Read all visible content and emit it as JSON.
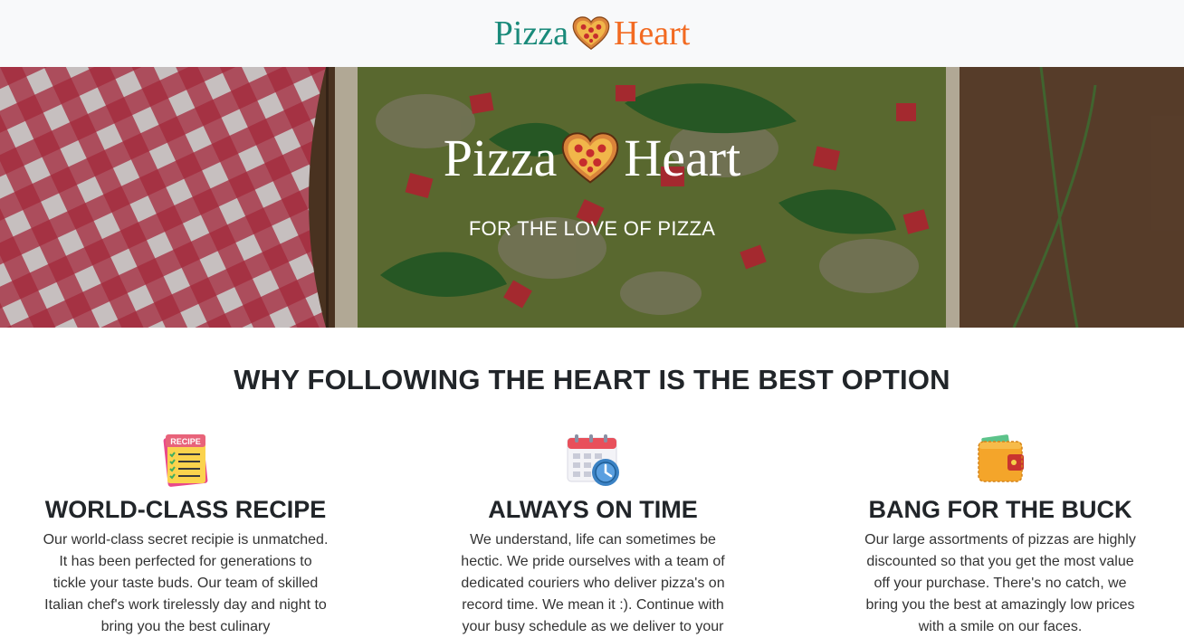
{
  "header": {
    "logo_word1": "Pizza",
    "logo_word2": "Heart"
  },
  "hero": {
    "logo_word1": "Pizza",
    "logo_word2": "Heart",
    "tagline": "FOR THE LOVE OF PIZZA"
  },
  "features": {
    "heading": "WHY FOLLOWING THE HEART IS THE BEST OPTION",
    "items": [
      {
        "icon": "recipe-icon",
        "title": "WORLD-CLASS RECIPE",
        "text": "Our world-class secret recipie is unmatched. It has been perfected for generations to tickle your taste buds. Our team of skilled Italian chef's work tirelessly day and night to bring you the best culinary"
      },
      {
        "icon": "calendar-clock-icon",
        "title": "ALWAYS ON TIME",
        "text": "We understand, life can sometimes be hectic. We pride ourselves with a team of dedicated couriers who deliver pizza's on record time. We mean it :). Continue with your busy schedule as we deliver to your"
      },
      {
        "icon": "wallet-icon",
        "title": "BANG FOR THE BUCK",
        "text": "Our large assortments of pizzas are highly discounted so that you get the most value off your purchase. There's no catch, we bring you the best at amazingly low prices with a smile on our faces."
      }
    ]
  },
  "colors": {
    "brand_teal": "#1a8a7a",
    "brand_orange": "#f26a21",
    "topbar_bg": "#f8f9fa"
  }
}
